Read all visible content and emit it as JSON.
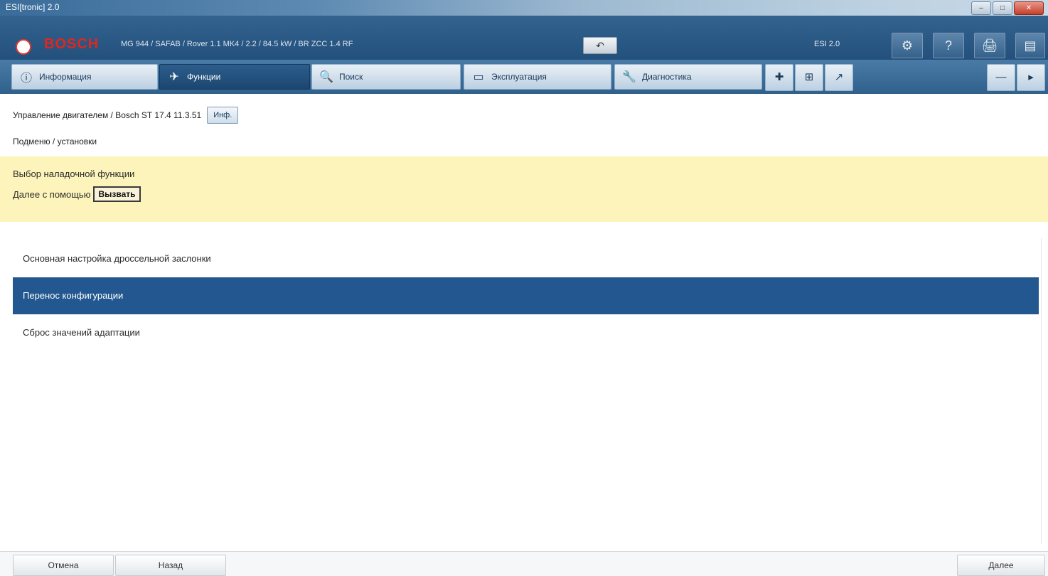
{
  "window": {
    "title": "ESI[tronic] 2.0"
  },
  "brand": {
    "name": "BOSCH"
  },
  "header": {
    "vehicle_info": "MG 944 / SAFAB / Rover 1.1 MK4 / 2.2 / 84.5 kW / BR ZCC 1.4 RF",
    "back_icon": "undo-icon",
    "esi_label": "ESI 2.0",
    "tools": [
      {
        "icon": "⚙",
        "name": "settings"
      },
      {
        "icon": "?",
        "name": "help"
      },
      {
        "icon": "🖨",
        "name": "print"
      },
      {
        "icon": "▤",
        "name": "menu"
      }
    ]
  },
  "nav": {
    "tabs": [
      {
        "label": "Информация",
        "icon": "ⓘ"
      },
      {
        "label": "Функции",
        "icon": "✈",
        "active": true
      },
      {
        "label": "Поиск",
        "icon": "🔍"
      },
      {
        "label": "Эксплуатация",
        "icon": "▭"
      },
      {
        "label": "Диагностика",
        "icon": "🔧"
      }
    ],
    "small_buttons": [
      "✚",
      "⊞",
      "↗"
    ],
    "right_buttons": [
      "—",
      "▸"
    ]
  },
  "breadcrumb": {
    "path": "Управление двигателем / Bosch ST 17.4 11.3.51",
    "button": "Инф.",
    "sub": "Подменю / установки"
  },
  "info": {
    "line1": "Выбор наладочной функции",
    "line2_prefix": "Далее с помощью",
    "line2_button": "Вызвать"
  },
  "list": {
    "items": [
      {
        "label": "Основная настройка дроссельной заслонки",
        "selected": false
      },
      {
        "label": "Перенос конфигурации",
        "selected": true
      },
      {
        "label": "Сброс значений адаптации",
        "selected": false
      }
    ]
  },
  "footer": {
    "btn_left1": "Отмена",
    "btn_left2": "Назад",
    "btn_right": "Далее"
  },
  "colors": {
    "accent": "#22588f",
    "brand_red": "#e3261b",
    "info_band": "#fcf4ba"
  }
}
